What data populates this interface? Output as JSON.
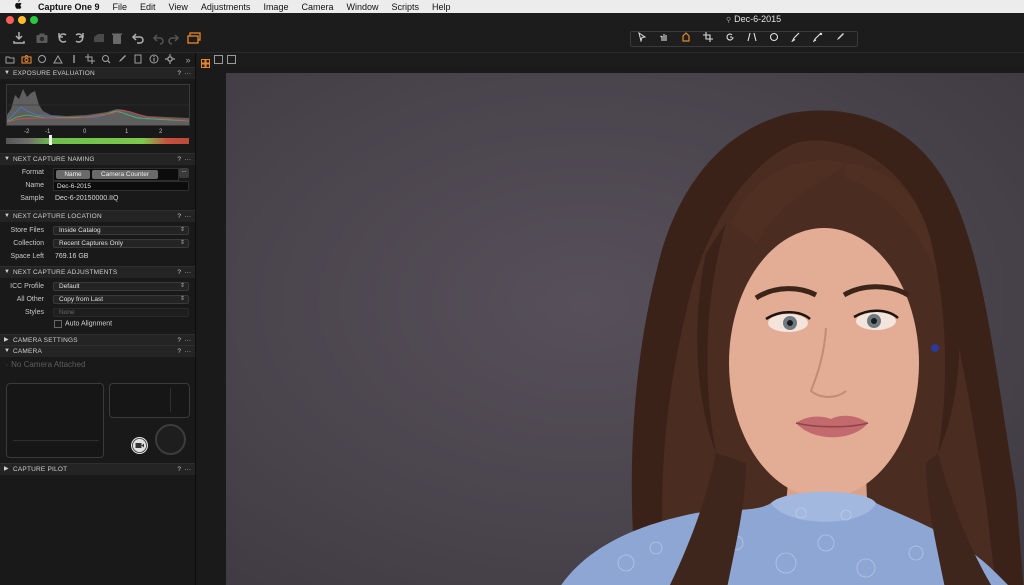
{
  "menubar": {
    "apple_icon": "",
    "app_name": "Capture One 9",
    "items": [
      "File",
      "Edit",
      "View",
      "Adjustments",
      "Image",
      "Camera",
      "Window",
      "Scripts",
      "Help"
    ]
  },
  "window": {
    "title": "Dec-6-2015",
    "traffic_colors": {
      "close": "#ff5f57",
      "minimize": "#febc2e",
      "zoom": "#28c840"
    }
  },
  "toolbar": {
    "icons": [
      "import-icon",
      "camera-capture-icon",
      "rotate-left-icon",
      "rotate-right-icon",
      "move-to-selects-icon",
      "trash-icon",
      "reset-icon",
      "undo-icon",
      "redo-icon",
      "layers-icon"
    ],
    "cursor_tools": [
      "select-cursor-icon",
      "pan-icon",
      "loupe-icon",
      "crop-icon",
      "rotate-tool-icon",
      "keystone-icon",
      "spot-removal-icon",
      "brush-icon",
      "picker-icon",
      "annotate-icon"
    ],
    "accent_color": "#e8872a"
  },
  "panel": {
    "tab_icons": [
      "library-icon",
      "capture-icon",
      "lens-icon",
      "color-icon",
      "exposure-icon",
      "composition-icon",
      "details-icon",
      "local-adjustments-icon",
      "adjustments-icon",
      "metadata-icon",
      "output-icon"
    ],
    "more_tabs": "»",
    "exposure": {
      "title": "EXPOSURE EVALUATION",
      "ticks": [
        "-2",
        "-1",
        "0",
        "1",
        "2"
      ],
      "help": "?",
      "menu": "···"
    },
    "naming": {
      "title": "NEXT CAPTURE NAMING",
      "format_label": "Format",
      "format_tokens": [
        "Name",
        "Camera Counter"
      ],
      "format_more": "...",
      "name_label": "Name",
      "name_value": "Dec-6-2015",
      "sample_label": "Sample",
      "sample_value": "Dec-6-20150000.IIQ"
    },
    "location": {
      "title": "NEXT CAPTURE LOCATION",
      "store_label": "Store Files",
      "store_value": "Inside Catalog",
      "collection_label": "Collection",
      "collection_value": "Recent Captures Only",
      "space_label": "Space Left",
      "space_value": "769.16 GB"
    },
    "adjustments": {
      "title": "NEXT CAPTURE ADJUSTMENTS",
      "icc_label": "ICC Profile",
      "icc_value": "Default",
      "allother_label": "All Other",
      "allother_value": "Copy from Last",
      "styles_label": "Styles",
      "styles_value": "None",
      "auto_alignment_label": "Auto Alignment"
    },
    "camera_settings": {
      "title": "CAMERA SETTINGS"
    },
    "camera": {
      "title": "CAMERA",
      "no_camera": "No Camera Attached"
    },
    "capture_pilot": {
      "title": "CAPTURE PILOT"
    }
  },
  "viewer": {
    "view_icons": [
      "multi-view-icon",
      "single-view-icon",
      "compare-view-icon"
    ],
    "photo_description_icon": "portrait-photo"
  }
}
